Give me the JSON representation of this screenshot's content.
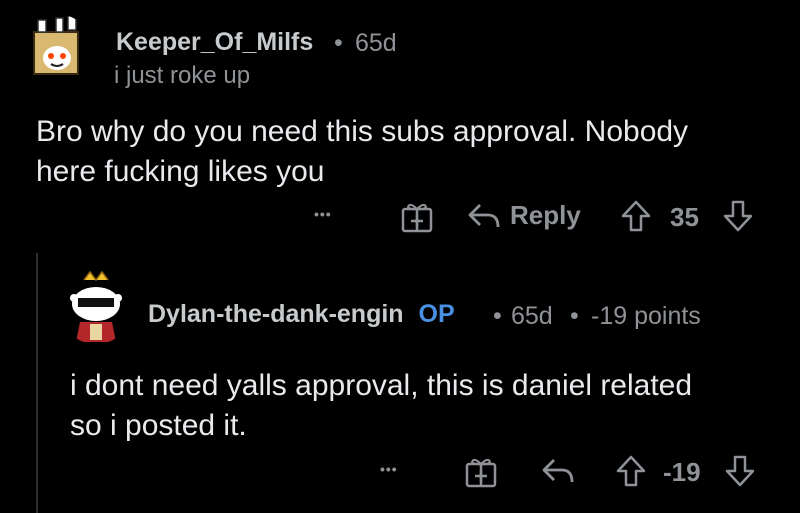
{
  "comment1": {
    "username": "Keeper_Of_Milfs",
    "separator": "•",
    "age": "65d",
    "flair": "i just roke up",
    "body_line1": "Bro why do you need this subs approval. Nobody",
    "body_line2": "here fucking likes you",
    "actions": {
      "more": "•••",
      "reply": "Reply",
      "score": "35"
    }
  },
  "comment2": {
    "username": "Dylan-the-dank-engin",
    "op_badge": "OP",
    "separator1": "•",
    "age": "65d",
    "separator2": "•",
    "points": "-19 points",
    "body_line1": "i dont need yalls approval, this is daniel related",
    "body_line2": "so i posted it.",
    "actions": {
      "more": "•••",
      "score": "-19"
    }
  },
  "colors": {
    "background": "#000000",
    "text": "#e8eaed",
    "muted": "#8f9296",
    "op": "#4a90e2"
  },
  "icons": [
    "snoo-avatar-box-icon",
    "snoo-avatar-sunglasses-icon",
    "more-icon",
    "gift-award-icon",
    "reply-arrow-icon",
    "upvote-icon",
    "downvote-icon"
  ]
}
